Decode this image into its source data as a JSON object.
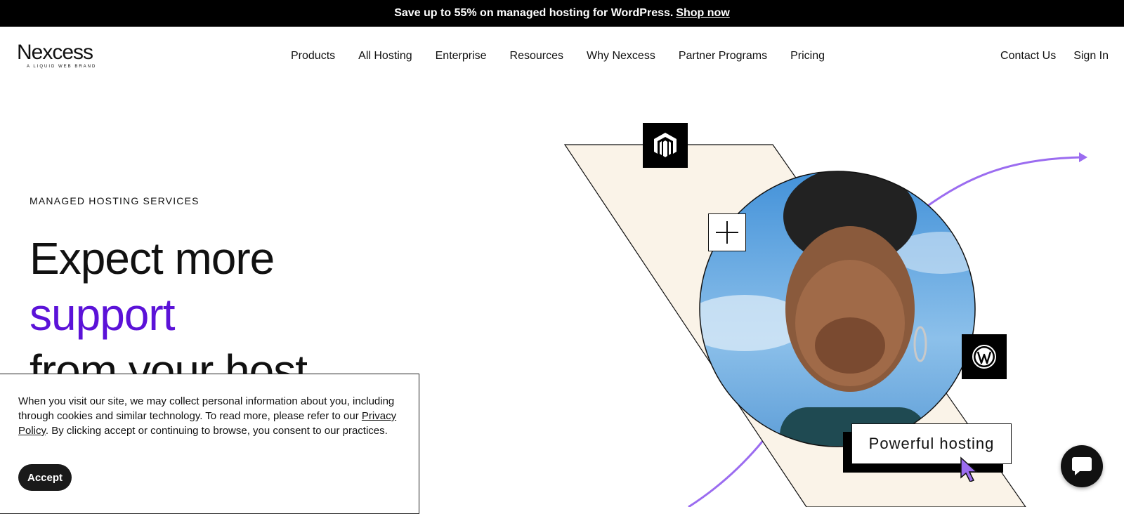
{
  "promo": {
    "text": "Save up to 55% on managed hosting for WordPress.",
    "link": "Shop now"
  },
  "logo": {
    "name": "Nexcess",
    "tagline": "A LIQUID WEB BRAND"
  },
  "nav": {
    "items": [
      "Products",
      "All Hosting",
      "Enterprise",
      "Resources",
      "Why Nexcess",
      "Partner Programs",
      "Pricing"
    ]
  },
  "utility": {
    "contact": "Contact Us",
    "signin": "Sign In"
  },
  "hero": {
    "eyebrow": "MANAGED HOSTING SERVICES",
    "line1": "Expect more",
    "line2": "support",
    "line3": "from your host",
    "pill": "Powerful hosting",
    "accent_color": "#5b12d8",
    "arrow_color": "#9b6cf0",
    "panel_color": "#faf3e8"
  },
  "cookie": {
    "text_before": "When you visit our site, we may collect personal information about you, including through cookies and similar technology. To read more, please refer to our ",
    "link": "Privacy Policy",
    "text_after": ". By clicking accept or continuing to browse, you consent to our practices.",
    "accept": "Accept"
  }
}
